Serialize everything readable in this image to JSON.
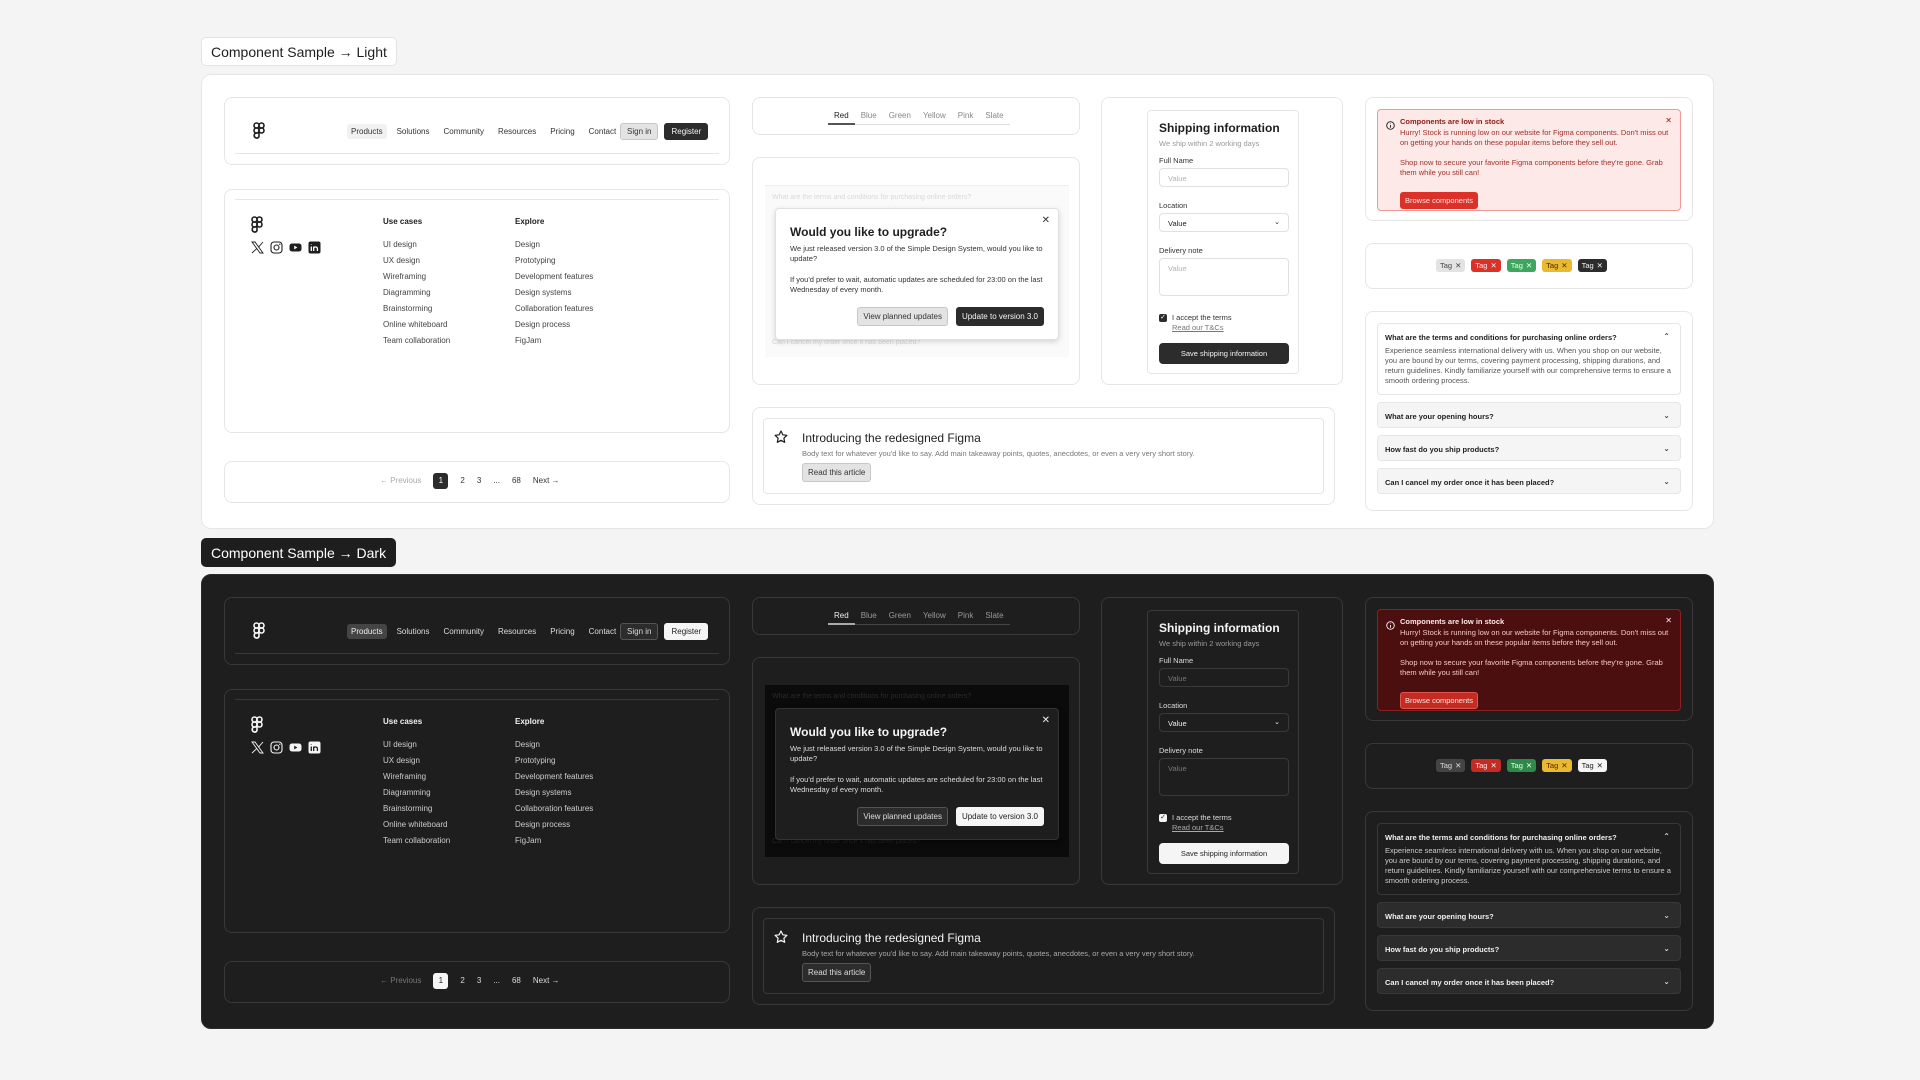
{
  "sections": {
    "light_label": "Component Sample → Light",
    "dark_label": "Component Sample → Dark"
  },
  "header": {
    "nav": [
      "Products",
      "Solutions",
      "Community",
      "Resources",
      "Pricing",
      "Contact"
    ],
    "active_nav": "Products",
    "sign_in": "Sign in",
    "register": "Register"
  },
  "footer": {
    "social_icons": [
      "x-icon",
      "instagram-icon",
      "youtube-icon",
      "linkedin-icon"
    ],
    "columns": [
      {
        "heading": "Use cases",
        "items": [
          "UI design",
          "UX design",
          "Wireframing",
          "Diagramming",
          "Brainstorming",
          "Online whiteboard",
          "Team collaboration"
        ]
      },
      {
        "heading": "Explore",
        "items": [
          "Design",
          "Prototyping",
          "Development features",
          "Design systems",
          "Collaboration features",
          "Design process",
          "FigJam"
        ]
      }
    ]
  },
  "pagination": {
    "previous": "← Previous",
    "pages": [
      "1",
      "2",
      "3",
      "...",
      "68"
    ],
    "current": "1",
    "next": "Next →"
  },
  "tabs": {
    "items": [
      "Red",
      "Blue",
      "Green",
      "Yellow",
      "Pink",
      "Slate"
    ],
    "active": "Red"
  },
  "dialog": {
    "title": "Would you like to upgrade?",
    "p1": "We just released version 3.0 of the Simple Design System, would you like to update?",
    "p2": "If you'd prefer to wait, automatic updates are scheduled for 23:00 on the last Wednesday of every month.",
    "secondary": "View planned updates",
    "primary": "Update to version 3.0",
    "background_first": "What are the terms and conditions for purchasing online orders?",
    "background_last": "Can I cancel my order once it has been placed?"
  },
  "card": {
    "title": "Introducing the redesigned Figma",
    "body": "Body text for whatever you'd like to say. Add main takeaway points, quotes, anecdotes, or even a very very short story.",
    "button": "Read this article"
  },
  "form": {
    "title": "Shipping information",
    "subtitle": "We ship within 2 working days",
    "full_name_label": "Full Name",
    "full_name_placeholder": "Value",
    "location_label": "Location",
    "location_value": "Value",
    "delivery_label": "Delivery note",
    "delivery_placeholder": "Value",
    "terms_checked": true,
    "terms_label": "I accept the terms",
    "terms_link": "Read our T&Cs",
    "submit": "Save shipping information"
  },
  "alert": {
    "title": "Components are low in stock",
    "body1": "Hurry! Stock is running low on our website for Figma components. Don't miss out on getting your hands on these popular items before they sell out.",
    "body2": "Shop now to secure your favorite Figma components before they're gone. Grab them while you still can!",
    "button": "Browse components",
    "danger_color": "#dc3128"
  },
  "tags": {
    "label": "Tag",
    "variants": [
      "neutral",
      "danger",
      "success",
      "warning",
      "inverse"
    ],
    "colors_light": {
      "neutral": "#e3e3e3",
      "danger": "#dc3128",
      "success": "#3ea65e",
      "warning": "#e8b931",
      "inverse": "#2c2c2c"
    },
    "colors_dark": {
      "neutral": "#444444",
      "danger": "#c42b22",
      "success": "#2f8a4a",
      "warning": "#e8b931",
      "inverse": "#f5f5f5"
    }
  },
  "accordion": {
    "items": [
      {
        "q": "What are the terms and conditions for purchasing online orders?",
        "a": "Experience seamless international delivery with us. When you shop on our website, you are bound by our terms, covering payment processing, shipping durations, and return guidelines. Kindly familiarize yourself with our comprehensive terms to ensure a smooth ordering process.",
        "open": true
      },
      {
        "q": "What are your opening hours?",
        "open": false
      },
      {
        "q": "How fast do you ship products?",
        "open": false
      },
      {
        "q": "Can I cancel my order once it has been placed?",
        "open": false
      }
    ]
  }
}
